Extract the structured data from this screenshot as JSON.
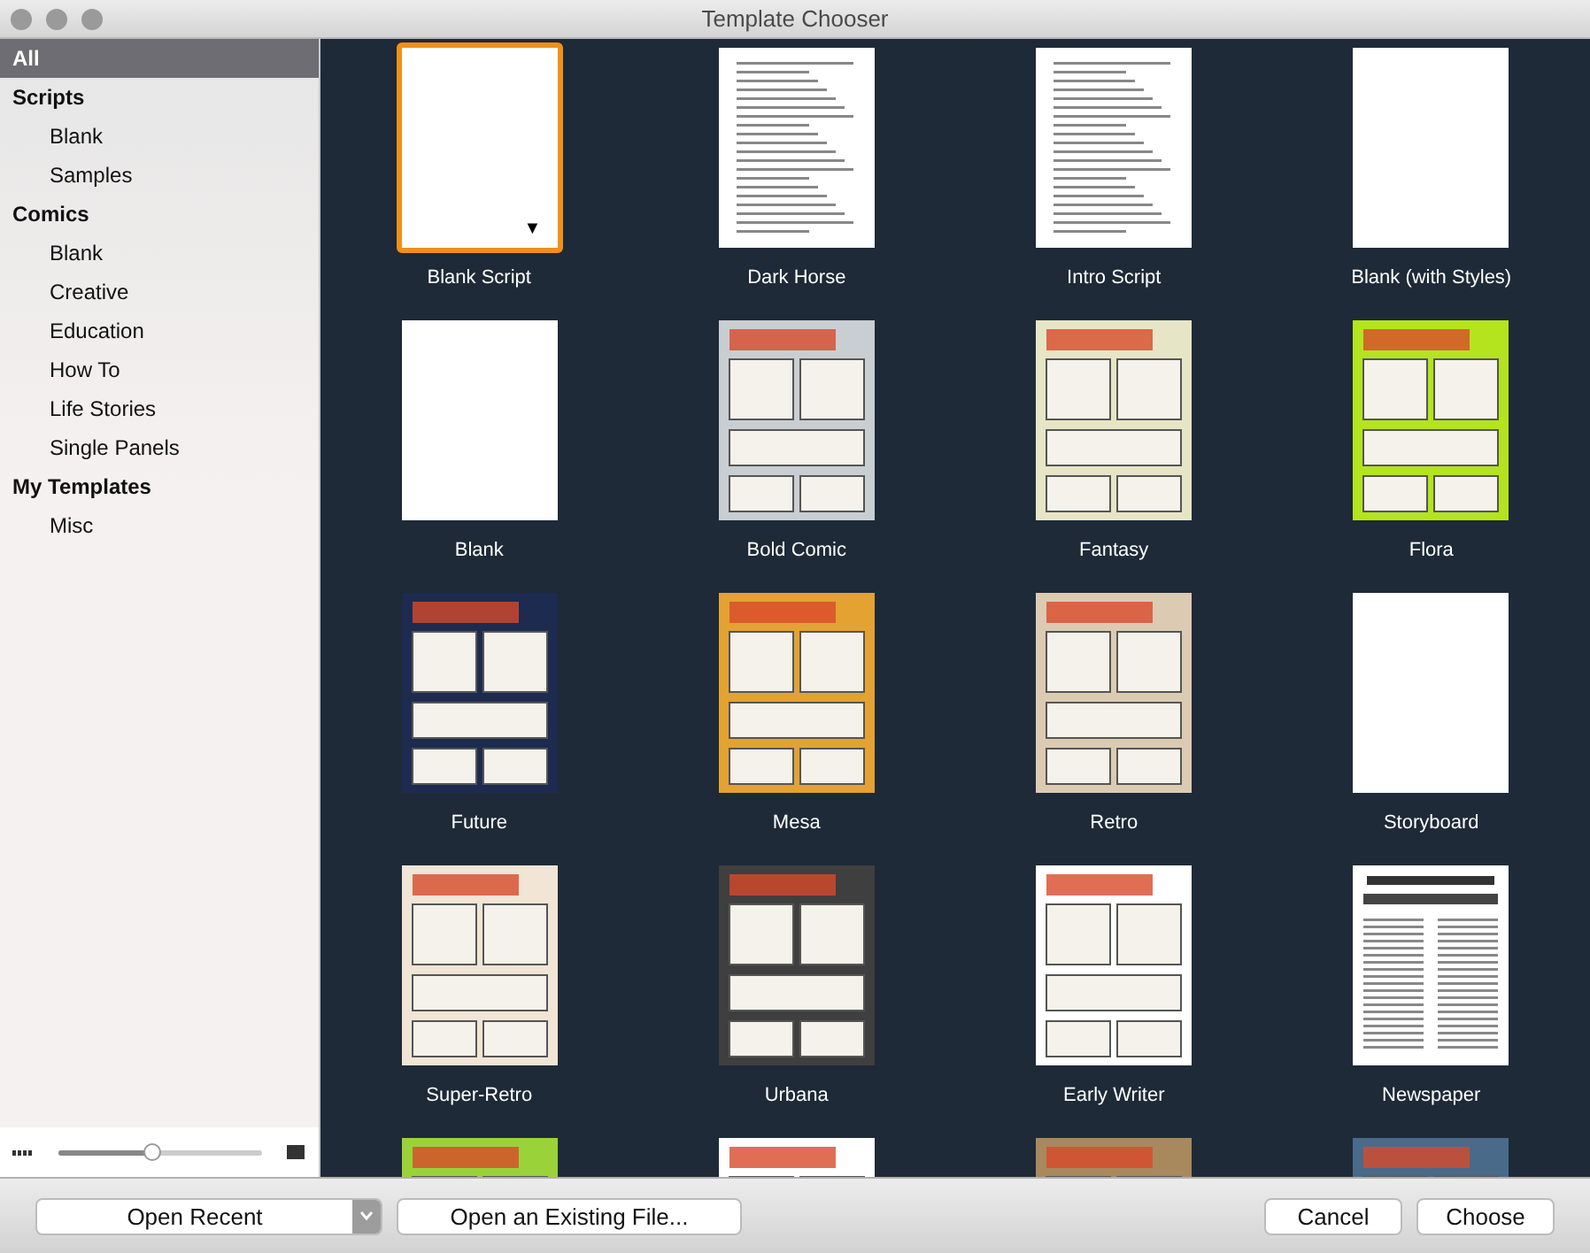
{
  "window": {
    "title": "Template Chooser"
  },
  "sidebar": {
    "items": [
      {
        "label": "All",
        "selected": true
      },
      {
        "label": "Scripts",
        "selected": false,
        "children": [
          {
            "label": "Blank",
            "selected": false
          },
          {
            "label": "Samples",
            "selected": false
          }
        ]
      },
      {
        "label": "Comics",
        "selected": false,
        "children": [
          {
            "label": "Blank",
            "selected": false
          },
          {
            "label": "Creative",
            "selected": false
          },
          {
            "label": "Education",
            "selected": false
          },
          {
            "label": "How To",
            "selected": false
          },
          {
            "label": "Life Stories",
            "selected": false
          },
          {
            "label": "Single Panels",
            "selected": false
          }
        ]
      },
      {
        "label": "My Templates",
        "selected": false,
        "children": [
          {
            "label": "Misc",
            "selected": false
          }
        ]
      }
    ],
    "zoom_slider": {
      "level": 0.46
    }
  },
  "templates": [
    {
      "label": "Blank Script",
      "kind": "blank",
      "selected": true,
      "menu": "▼"
    },
    {
      "label": "Dark Horse",
      "kind": "script",
      "selected": false
    },
    {
      "label": "Intro Script",
      "kind": "script",
      "selected": false
    },
    {
      "label": "Blank (with Styles)",
      "kind": "blank",
      "selected": false
    },
    {
      "label": "Blank",
      "kind": "blank",
      "selected": false
    },
    {
      "label": "Bold Comic",
      "kind": "comic",
      "color": "#c9ced3",
      "selected": false
    },
    {
      "label": "Fantasy",
      "kind": "comic",
      "color": "#e6e6c6",
      "selected": false
    },
    {
      "label": "Flora",
      "kind": "comic",
      "color": "#b4e41e",
      "selected": false
    },
    {
      "label": "Future",
      "kind": "comic",
      "color": "#1d2b50",
      "selected": false
    },
    {
      "label": "Mesa",
      "kind": "comic",
      "color": "#e3a232",
      "selected": false
    },
    {
      "label": "Retro",
      "kind": "comic",
      "color": "#dccbb3",
      "selected": false
    },
    {
      "label": "Storyboard",
      "kind": "blank",
      "selected": false
    },
    {
      "label": "Super-Retro",
      "kind": "comic",
      "color": "#f1e5d5",
      "selected": false
    },
    {
      "label": "Urbana",
      "kind": "comic",
      "color": "#3f3f3f",
      "selected": false
    },
    {
      "label": "Early Writer",
      "kind": "comic",
      "color": "#ffffff",
      "selected": false
    },
    {
      "label": "Newspaper",
      "kind": "news",
      "selected": false
    },
    {
      "kind": "comic",
      "color": "#9ad23a",
      "selected": false
    },
    {
      "kind": "comic",
      "color": "#ffffff",
      "selected": false
    },
    {
      "kind": "comic",
      "color": "#a8895e",
      "selected": false
    },
    {
      "kind": "comic",
      "color": "#4a6a8a",
      "selected": false
    }
  ],
  "buttons": {
    "open_recent": "Open Recent",
    "open_existing": "Open an Existing File...",
    "cancel": "Cancel",
    "choose": "Choose"
  }
}
